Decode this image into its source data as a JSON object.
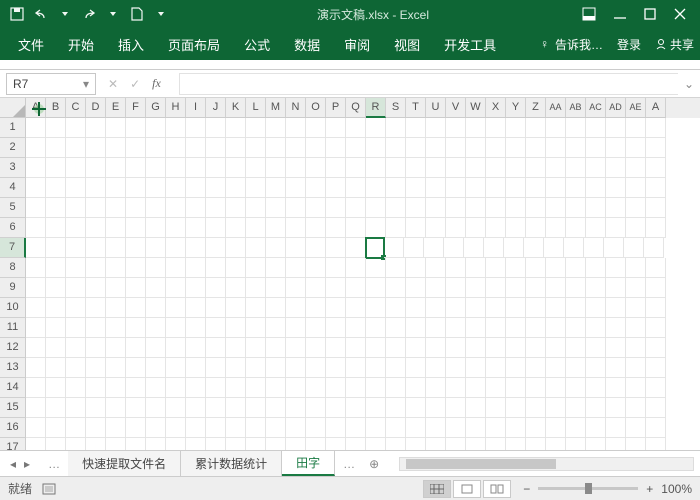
{
  "title": "演示文稿.xlsx - Excel",
  "tabs": [
    "文件",
    "开始",
    "插入",
    "页面布局",
    "公式",
    "数据",
    "审阅",
    "视图",
    "开发工具"
  ],
  "tellme": "告诉我…",
  "signin": "登录",
  "share": "共享",
  "namebox": "R7",
  "columns": [
    "A",
    "B",
    "C",
    "D",
    "E",
    "F",
    "G",
    "H",
    "I",
    "J",
    "K",
    "L",
    "M",
    "N",
    "O",
    "P",
    "Q",
    "R",
    "S",
    "T",
    "U",
    "V",
    "W",
    "X",
    "Y",
    "Z",
    "AA",
    "AB",
    "AC",
    "AD",
    "AE",
    "A"
  ],
  "rows": [
    "1",
    "2",
    "3",
    "4",
    "5",
    "6",
    "7",
    "8",
    "9",
    "10",
    "11",
    "12",
    "13",
    "14",
    "15",
    "16",
    "17"
  ],
  "activeCol": 18,
  "activeRow": 7,
  "sheets": {
    "hidden1": "…",
    "s1": "快速提取文件名",
    "s2": "累计数据统计",
    "s3": "田字",
    "hidden2": "…"
  },
  "activeSheet": "s3",
  "status": "就绪",
  "zoom": "100%"
}
